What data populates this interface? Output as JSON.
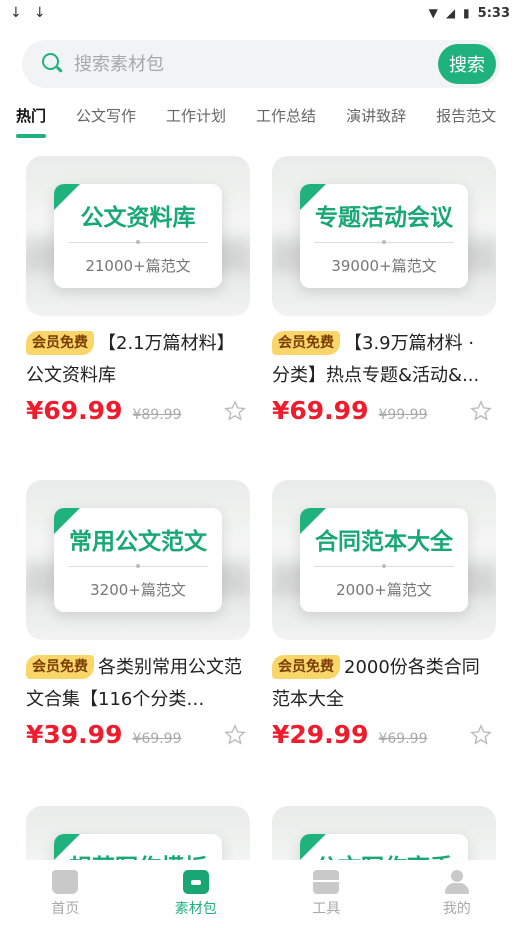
{
  "status_bar": {
    "left_icons": [
      "↓",
      "↓"
    ],
    "time": "5:33",
    "icons": [
      "wifi-icon",
      "signal-icon",
      "battery-icon"
    ]
  },
  "search": {
    "placeholder": "搜索素材包",
    "button_label": "搜索"
  },
  "tabs": [
    {
      "label": "热门",
      "active": true
    },
    {
      "label": "公文写作"
    },
    {
      "label": "工作计划"
    },
    {
      "label": "工作总结"
    },
    {
      "label": "演讲致辞"
    },
    {
      "label": "报告范文"
    }
  ],
  "products": [
    {
      "cover_title": "公文资料库",
      "cover_sub": "21000+篇范文",
      "badge": "会员免费",
      "title": "【2.1万篇材料】公文资料库",
      "price": "¥69.99",
      "old_price": "¥89.99"
    },
    {
      "cover_title": "专题活动会议",
      "cover_sub": "39000+篇范文",
      "badge": "会员免费",
      "title": "【3.9万篇材料 · 分类】热点专题&活动&...",
      "price": "¥69.99",
      "old_price": "¥99.99"
    },
    {
      "cover_title": "常用公文范文",
      "cover_sub": "3200+篇范文",
      "badge": "会员免费",
      "title": "各类别常用公文范文合集【116个分类…",
      "price": "¥39.99",
      "old_price": "¥69.99"
    },
    {
      "cover_title": "合同范本大全",
      "cover_sub": "2000+篇范文",
      "badge": "会员免费",
      "title": "2000份各类合同范本大全",
      "price": "¥29.99",
      "old_price": "¥69.99"
    },
    {
      "cover_title": "规范写作模板",
      "cover_sub": "",
      "badge": "",
      "title": "",
      "price": "",
      "old_price": ""
    },
    {
      "cover_title": "公文写作高手",
      "cover_sub": "",
      "badge": "",
      "title": "",
      "price": "",
      "old_price": ""
    }
  ],
  "tabbar": [
    {
      "label": "首页",
      "icon": "home-icon"
    },
    {
      "label": "素材包",
      "icon": "folder-icon",
      "active": true
    },
    {
      "label": "工具",
      "icon": "toolbox-icon"
    },
    {
      "label": "我的",
      "icon": "user-icon"
    }
  ],
  "colors": {
    "accent": "#20b27c",
    "price": "#ee1c2c",
    "badge": "#f9d66a"
  }
}
